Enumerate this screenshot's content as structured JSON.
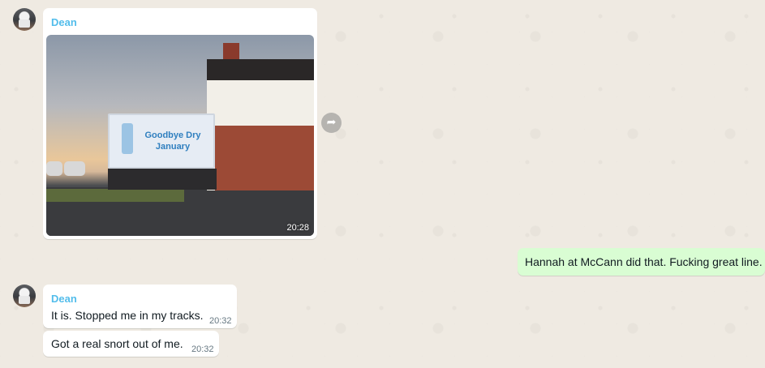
{
  "messages": [
    {
      "sender": "Dean",
      "type": "image",
      "image_alt": "Goodbye Dry January",
      "billboard_text": "Goodbye Dry January",
      "time": "20:28"
    },
    {
      "type": "outgoing",
      "text": "Hannah at McCann did that. Fucking great line."
    },
    {
      "sender": "Dean",
      "type": "text",
      "text": "It is. Stopped me in my tracks.",
      "time": "20:32"
    },
    {
      "type": "text",
      "text": "Got a real snort out of me.",
      "time": "20:32"
    }
  ],
  "colors": {
    "background": "#efeae2",
    "incoming_bubble": "#ffffff",
    "outgoing_bubble": "#d9fdd3",
    "sender_name": "#53bdeb",
    "timestamp": "#667781"
  },
  "icons": {
    "forward": "forward-arrow-icon",
    "avatar": "contact-avatar"
  }
}
